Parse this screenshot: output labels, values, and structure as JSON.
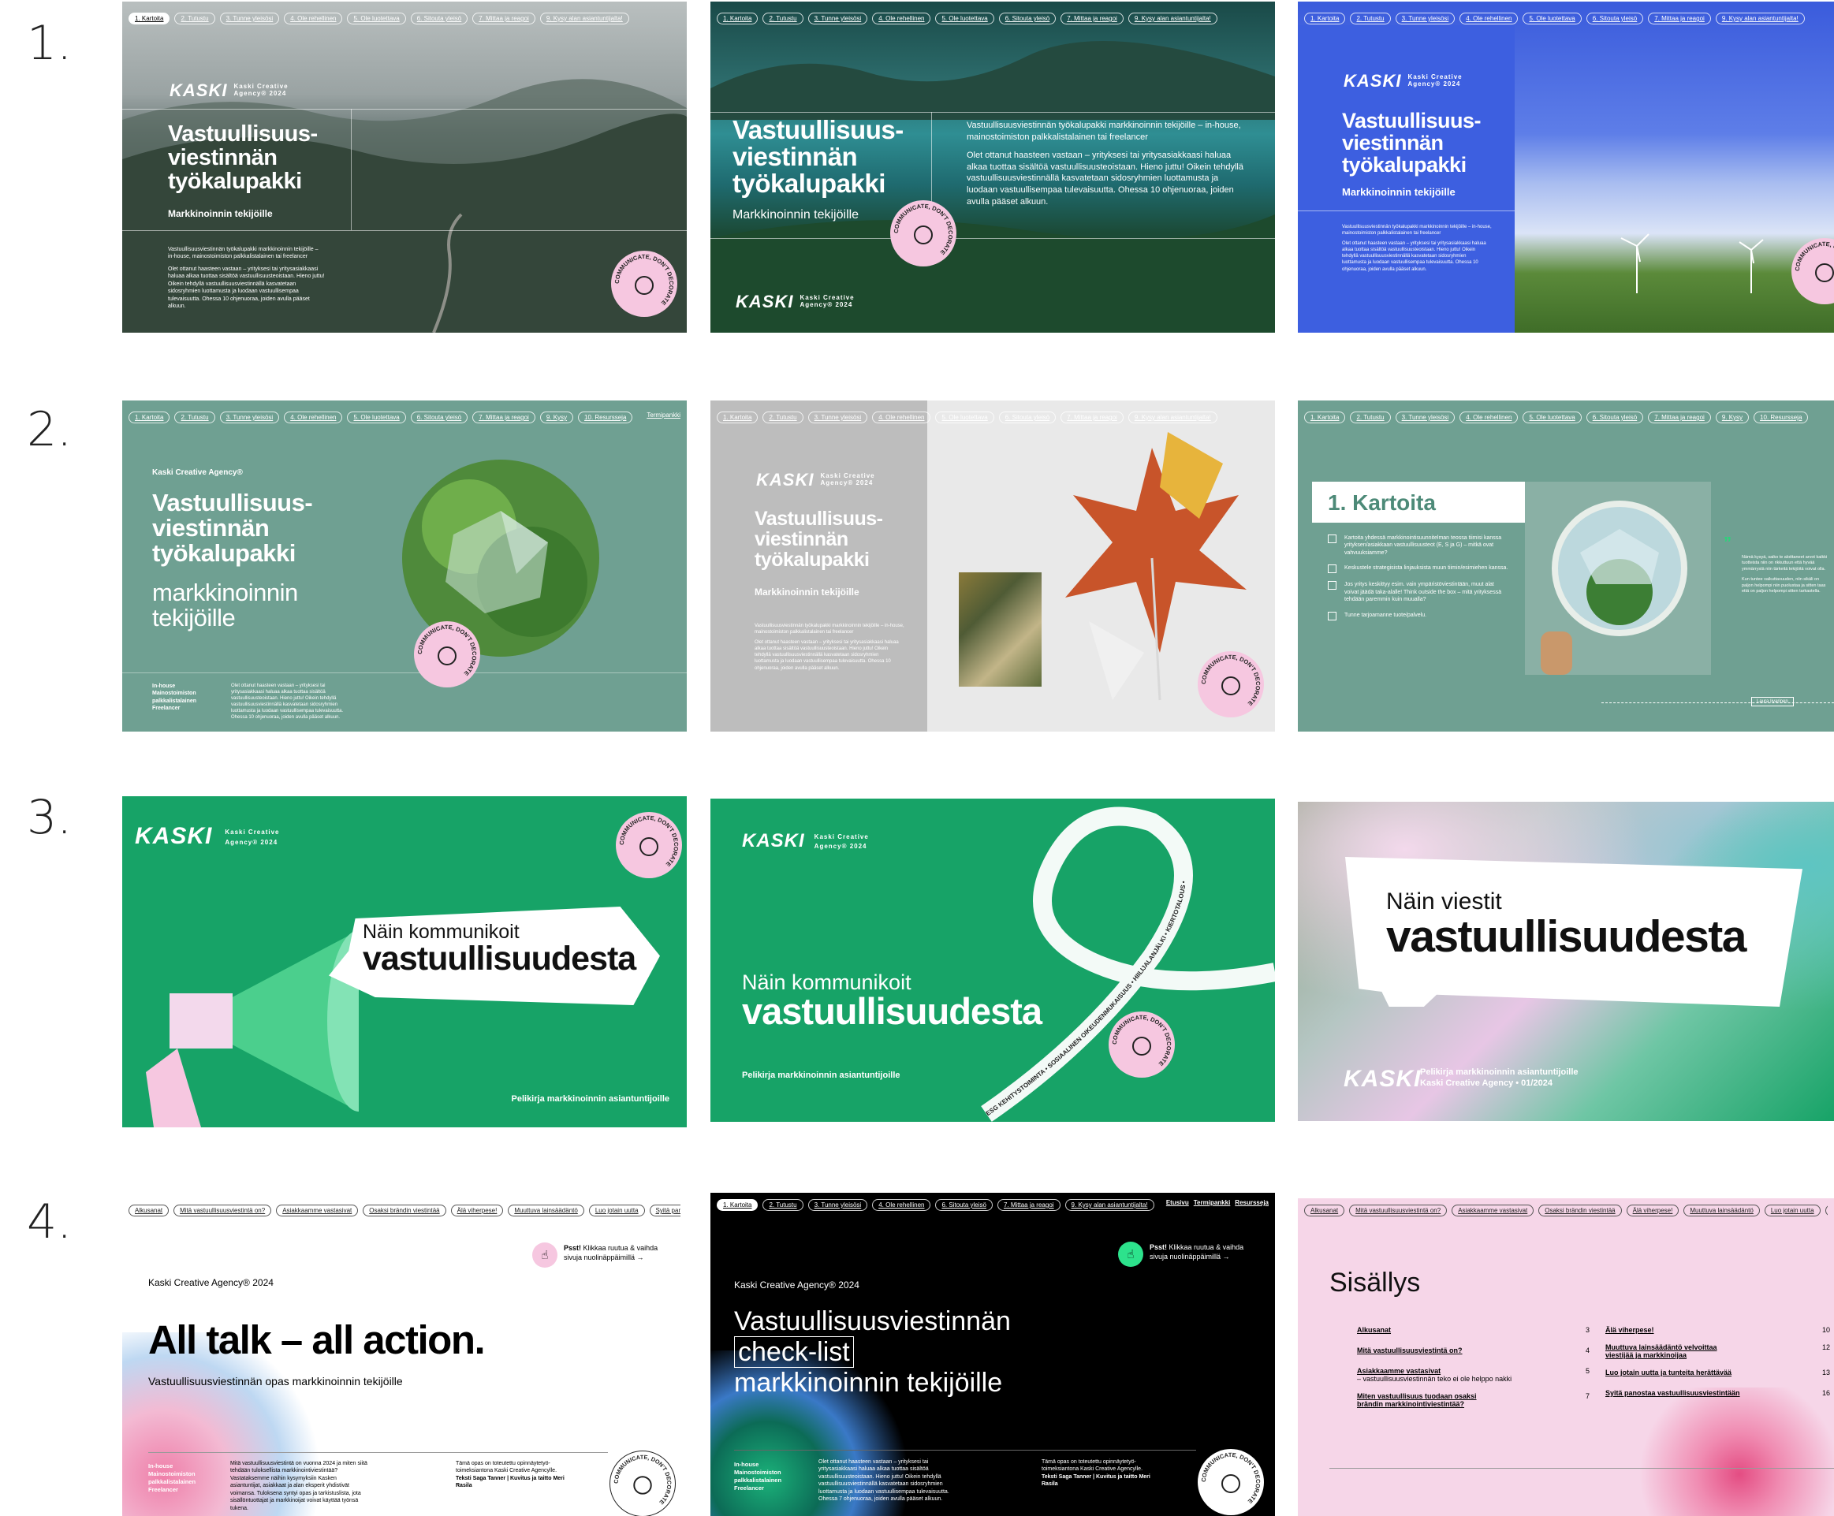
{
  "rows": [
    "1.",
    "2.",
    "3.",
    "4."
  ],
  "nav_main": [
    "1. Kartoita",
    "2. Tutustu",
    "3. Tunne yleisösi",
    "4. Ole rehellinen",
    "5. Ole luotettava",
    "6. Sitouta yleisö",
    "7. Mittaa ja reagoi",
    "9. Kysy alan asiantuntijalta!"
  ],
  "nav_ten": [
    "1. Kartoita",
    "2. Tutustu",
    "3. Tunne yleisösi",
    "4. Ole rehellinen",
    "5. Ole luotettava",
    "6. Sitouta yleisö",
    "7. Mittaa ja reagoi",
    "9. Kysy",
    "10. Resursseja"
  ],
  "nav_ten_extra": "Termipankki",
  "nav_contents": [
    "Alkusanat",
    "Mitä vastuullisuusviestintä on?",
    "Asiakkaamme vastasivat",
    "Osaksi brändin viestintää",
    "Älä viherpese!",
    "Muuttuva lainsäädäntö",
    "Luo jotain uutta",
    "Syitä panostaa"
  ],
  "nav_links": [
    "Etusivu",
    "Termipankki",
    "Resursseja"
  ],
  "logo": {
    "mark": "KASKI",
    "agency_line1": "Kaski Creative",
    "agency_line2": "Agency® 2024"
  },
  "badge_text": "COMMUNICATE, DON'T DECORATE",
  "toolkit": {
    "title_l1": "Vastuullisuus-",
    "title_l2": "viestinnän",
    "title_l3": "työkalupakki",
    "subtitle": "Markkinoinnin tekijöille",
    "subtitle_lower_l1": "markkinoinnin",
    "subtitle_lower_l2": "tekijöille",
    "agency_name": "Kaski Creative Agency®",
    "intro_p1": "Vastuullisuusviestinnän työkalupakki markkinoinnin tekijöille – in-house, mainostoimiston palkkalistalainen tai freelancer",
    "intro_p2": "Olet ottanut haasteen vastaan – yrityksesi tai yritysasiakkaasi haluaa alkaa tuottaa sisältöä vastuullisuusteoistaan. Hieno juttu! Oikein tehdyllä vastuullisuusviestinnällä kasvatetaan sidosryhmien luottamusta ja luodaan vastuullisempaa tulevaisuutta. Ohessa 10 ohjenuoraa, joiden avulla pääset alkuun.",
    "roles": [
      "In-house",
      "Mainostoimiston palkkalistalainen",
      "Freelancer"
    ]
  },
  "kartoita": {
    "heading": "1. Kartoita",
    "items": [
      "Kartoita yhdessä markkinointisuunnitelman teossa tiimisi kanssa yrityksen/asiakkaan vastuullisuusteot (E, S ja G) – mitkä ovat vahvuuksiamme?",
      "Keskustele strategisista linjauksista muun tiimin/esimiehen kanssa.",
      "Jos yritys keskittyy esim. vain ympäristöviestintään, muut alat voivat jäädä taka-alalle! Think outside the box – mitä yrityksessä tehdään paremmin kuin muualla?",
      "Tunne tarjoamanne tuote/palvelu."
    ],
    "quote": "Nämä kysyä, saiko te aloittaneet arvot kaikki tuotteista niin on rikkuttuun että hyvää ymmärrystä niin tärkeitä tekijöitä voivat olla.",
    "quote2": "Kun tuntee vaikuttavuuden, niin sikäli on paljon helpompi niin puolustaa ja sitten taas että on paljon helpompi sitten tarkastella.",
    "attribution": "Laura Iivarinen"
  },
  "comms": {
    "line1": "Näin kommunikoit",
    "line2": "vastuullisuudesta",
    "line1_alt": "Näin viestit",
    "playbook": "Pelikirja markkinoinnin asiantuntijoille",
    "agency_date": "Kaski Creative Agency • 01/2024",
    "ribbon": "ESG KEHITYSTOIMINTA • SOSIAALINEN OIKEUDENMUKAISUUS • HIILIJALANJÄLKI • KIERTOTALOUS •"
  },
  "guide": {
    "agency_year": "Kaski Creative Agency® 2024",
    "tip_bold": "Psst!",
    "tip_text": "Klikkaa ruutua & vaihda sivuja nuolinäppäimillä →",
    "headline": "All talk – all action.",
    "subhead": "Vastuullisuusviestinnän opas markkinoinnin tekijöille",
    "body": "Mitä vastuullisuusviestintä on vuonna 2024 ja miten siitä tehdään tuloksellista markkinointiviestintää? Vastataksemme näihin kysymyksiin Kasken asiantuntijat, asiakkaat ja alan eksperit yhdistivät voimansa. Tuloksena syntyi opas ja tarkistuslista, jota sisällöntuottajat ja markkinoijat voivat käyttää työnsä tukena.",
    "credit": "Tämä opas on toteutettu opinnäytetyö-toimeksiantona Kaski Creative Agencylle.",
    "credit_names": "Teksti Saga Tanner | Kuvitus ja taitto Meri Rasila"
  },
  "checklist": {
    "l1": "Vastuullisuusviestinnän",
    "l2": "check-list",
    "l3": "markkinoinnin tekijöille",
    "body": "Olet ottanut haasteen vastaan – yrityksesi tai yritysasiakkaasi haluaa alkaa tuottaa sisältöä vastuullisuusteoistaan. Hieno juttu! Oikein tehdyllä vastuullisuusviestinnällä kasvatetaan sidosryhmien luottamusta ja luodaan vastuullisempaa tulevaisuutta. Ohessa 7 ohjenuoraa, joiden avulla pääset alkuun."
  },
  "contents": {
    "title": "Sisällys",
    "left": [
      {
        "label": "Alkusanat",
        "page": "3"
      },
      {
        "label": "Mitä vastuullisuusviestintä on?",
        "page": "4"
      },
      {
        "label": "Asiakkaamme vastasivat",
        "note": "– vastuullisuusviestinnän teko ei ole helppo nakki",
        "page": "5"
      },
      {
        "label": "Miten vastuullisuus tuodaan osaksi brändin markkinointiviestintää?",
        "page": "7"
      }
    ],
    "right": [
      {
        "label": "Älä viherpese!",
        "page": "10"
      },
      {
        "label": "Muuttuva lainsäädäntö velvoittaa viestijää ja markkinoijaa",
        "page": "12"
      },
      {
        "label": "Luo jotain uutta ja tunteita herättävää",
        "page": "13"
      },
      {
        "label": "Syitä panostaa vastuullisuusviestintään",
        "page": "16"
      }
    ]
  },
  "colors": {
    "green": "#17a367",
    "sage": "#6fa092",
    "blue": "#3d5fe0",
    "pink": "#f6c7e0",
    "black": "#000000"
  }
}
